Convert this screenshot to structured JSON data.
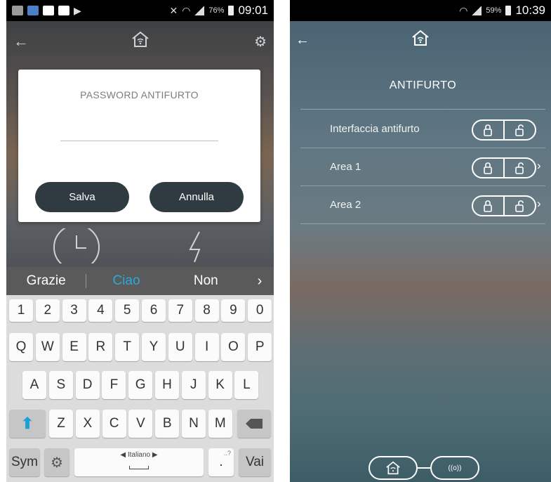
{
  "left": {
    "statusbar": {
      "battery_pct": "76%",
      "time": "09:01"
    },
    "dialog": {
      "title": "PASSWORD ANTIFURTO",
      "password_value": "",
      "save_label": "Salva",
      "cancel_label": "Annulla"
    },
    "keyboard": {
      "suggestions": [
        "Grazie",
        "Ciao",
        "Non"
      ],
      "active_suggestion": "Ciao",
      "row_numbers": [
        "1",
        "2",
        "3",
        "4",
        "5",
        "6",
        "7",
        "8",
        "9",
        "0"
      ],
      "row1": [
        "Q",
        "W",
        "E",
        "R",
        "T",
        "Y",
        "U",
        "I",
        "O",
        "P"
      ],
      "row2": [
        "A",
        "S",
        "D",
        "F",
        "G",
        "H",
        "J",
        "K",
        "L"
      ],
      "row3": [
        "Z",
        "X",
        "C",
        "V",
        "B",
        "N",
        "M"
      ],
      "sym_label": "Sym",
      "language_label": "Italiano",
      "period_label": ".",
      "period_sup": "..?",
      "go_label": "Vai"
    }
  },
  "right": {
    "statusbar": {
      "battery_pct": "59%",
      "time": "10:39"
    },
    "title": "ANTIFURTO",
    "rows": [
      {
        "label": "Interfaccia antifurto",
        "has_chevron": false
      },
      {
        "label": "Area 1",
        "has_chevron": true
      },
      {
        "label": "Area 2",
        "has_chevron": true
      }
    ],
    "bottom_nav_badge": "((o))"
  },
  "colors": {
    "dialog_button": "#2f3b40",
    "suggestion_active": "#2aa9dc",
    "shift_arrow": "#1ea0d6"
  }
}
